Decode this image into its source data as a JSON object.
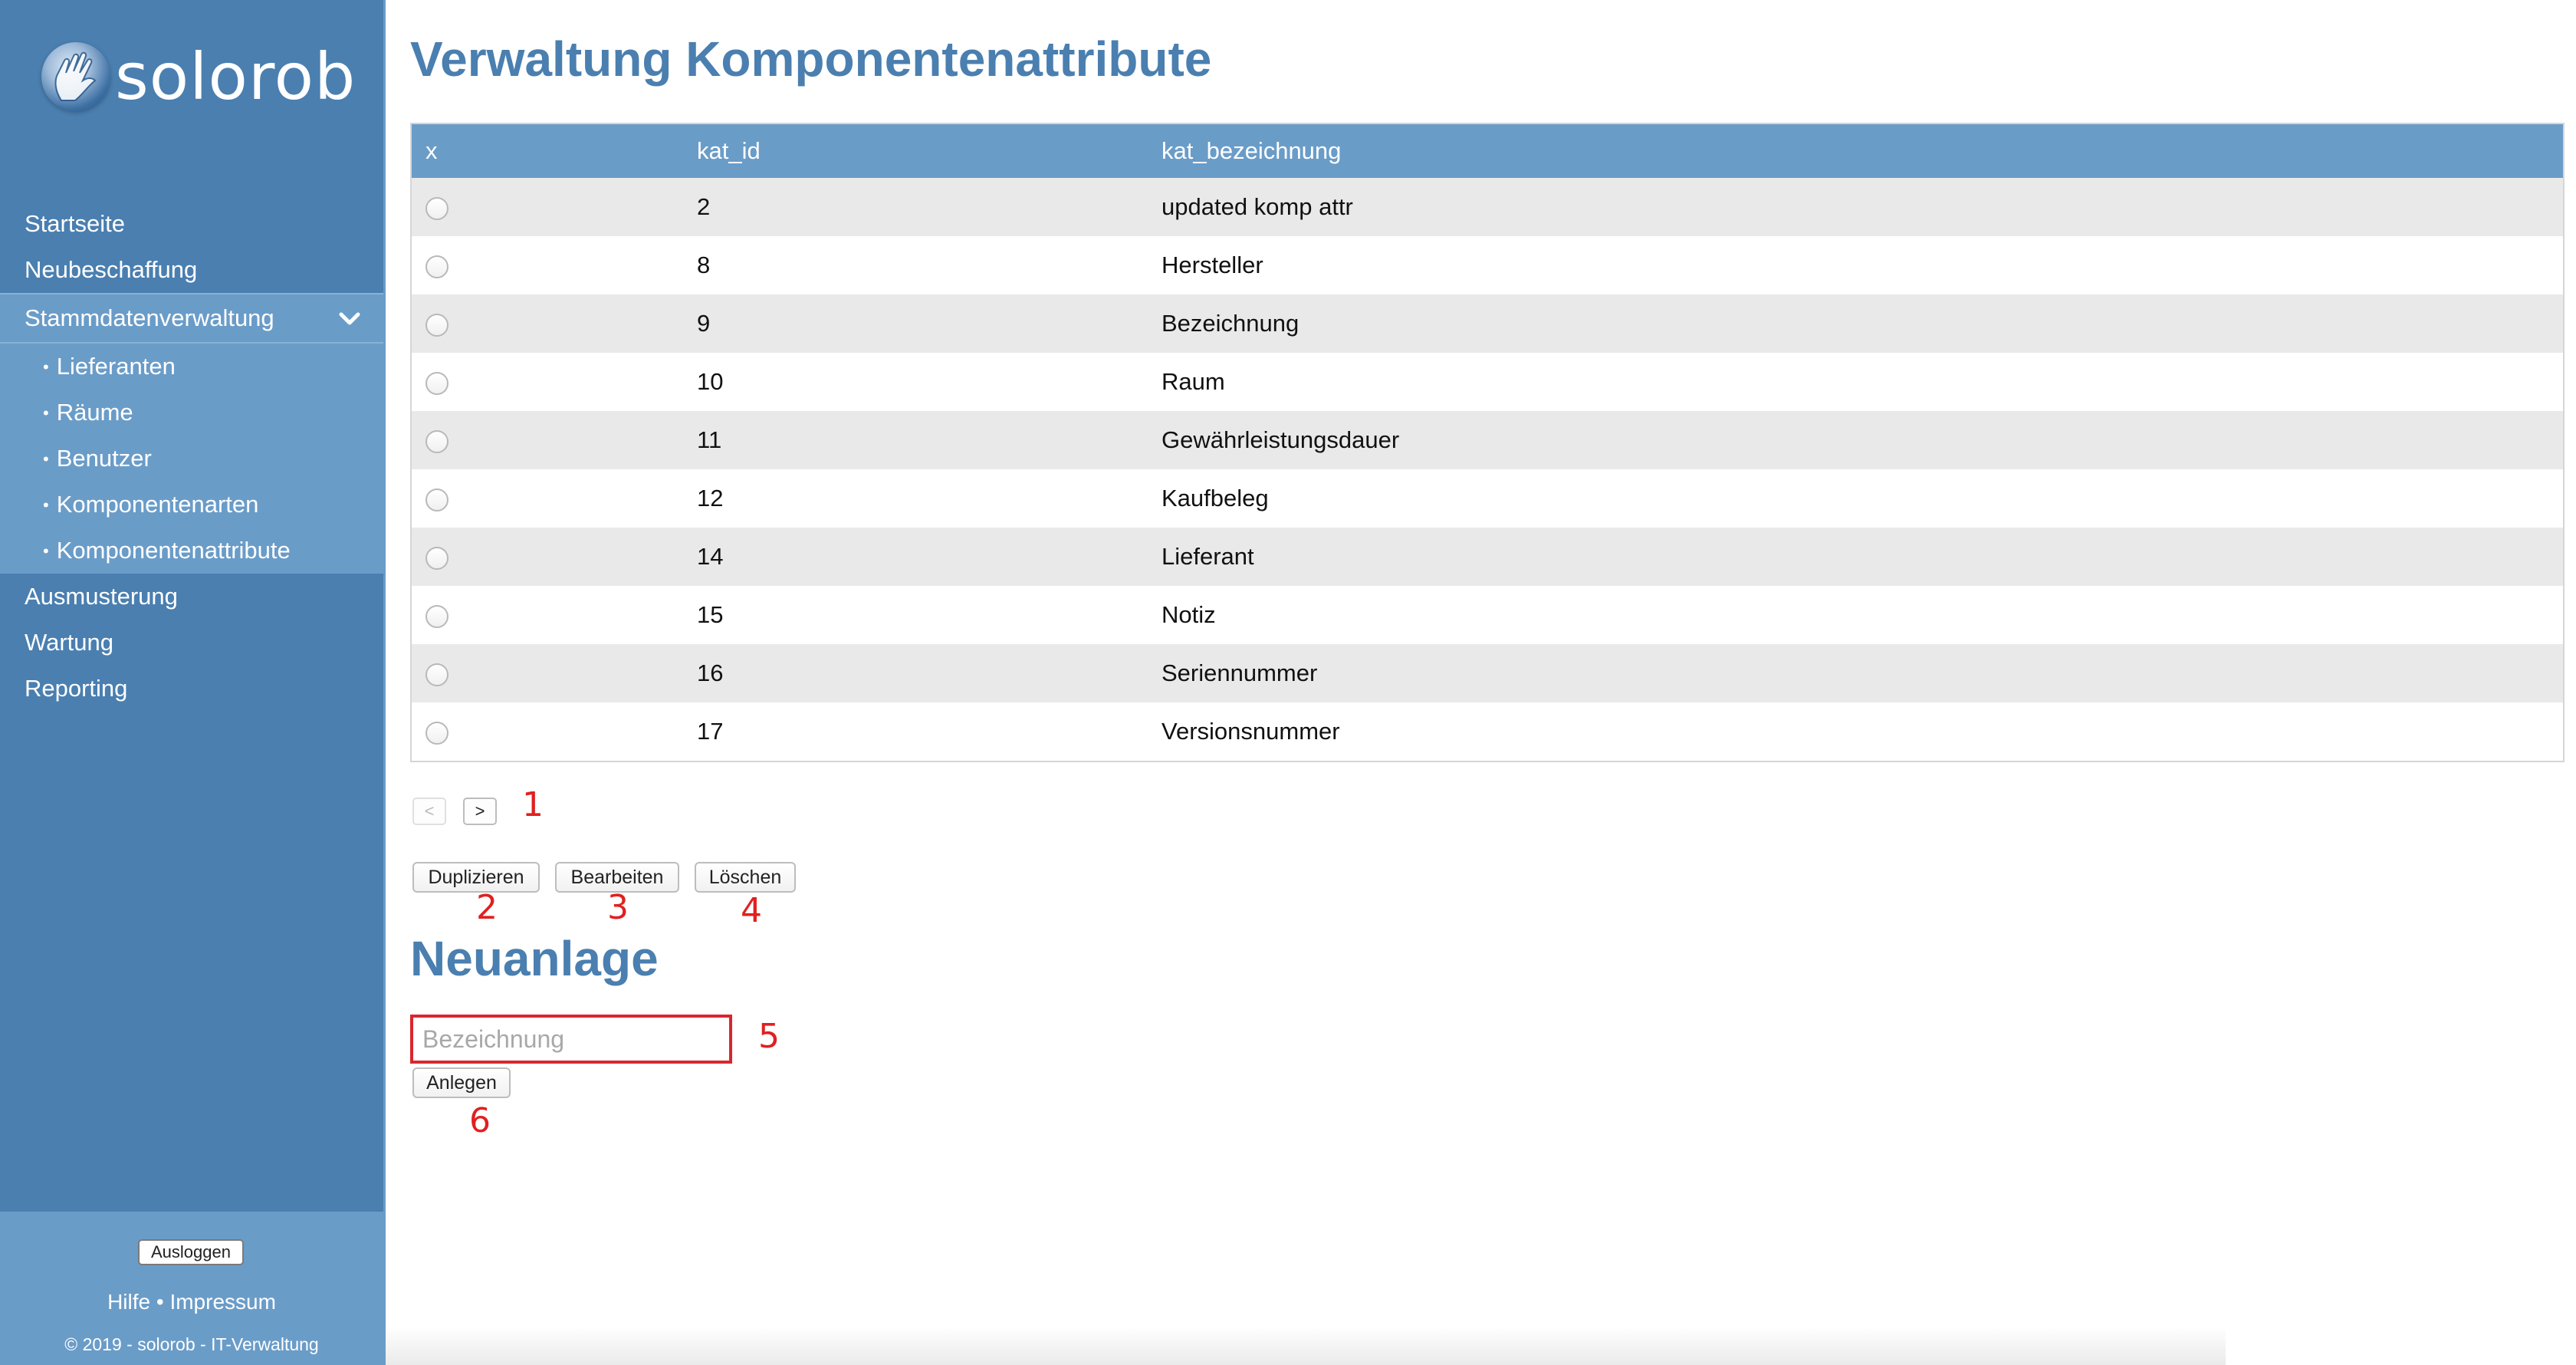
{
  "app": {
    "logo_text": "solorob"
  },
  "sidebar": {
    "items": [
      {
        "label": "Startseite"
      },
      {
        "label": "Neubeschaffung"
      },
      {
        "label": "Stammdatenverwaltung"
      },
      {
        "label": "Ausmusterung"
      },
      {
        "label": "Wartung"
      },
      {
        "label": "Reporting"
      }
    ],
    "subitems": [
      {
        "label": "Lieferanten"
      },
      {
        "label": "Räume"
      },
      {
        "label": "Benutzer"
      },
      {
        "label": "Komponentenarten"
      },
      {
        "label": "Komponentenattribute"
      }
    ],
    "bullet": "•",
    "logout_label": "Ausloggen",
    "footer_help": "Hilfe",
    "footer_sep": "•",
    "footer_impressum": "Impressum",
    "copyright": "© 2019 - solorob - IT-Verwaltung"
  },
  "main": {
    "title": "Verwaltung Komponentenattribute",
    "table": {
      "headers": [
        "x",
        "kat_id",
        "kat_bezeichnung"
      ],
      "rows": [
        {
          "id": "2",
          "name": "updated komp attr"
        },
        {
          "id": "8",
          "name": "Hersteller"
        },
        {
          "id": "9",
          "name": "Bezeichnung"
        },
        {
          "id": "10",
          "name": "Raum"
        },
        {
          "id": "11",
          "name": "Gewährleistungsdauer"
        },
        {
          "id": "12",
          "name": "Kaufbeleg"
        },
        {
          "id": "14",
          "name": "Lieferant"
        },
        {
          "id": "15",
          "name": "Notiz"
        },
        {
          "id": "16",
          "name": "Seriennummer"
        },
        {
          "id": "17",
          "name": "Versionsnummer"
        }
      ]
    },
    "pager": {
      "prev": "<",
      "next": ">"
    },
    "actions": {
      "duplicate": "Duplizieren",
      "edit": "Bearbeiten",
      "delete": "Löschen"
    },
    "new_section": {
      "title": "Neuanlage",
      "input_placeholder": "Bezeichnung",
      "input_value": "",
      "create_label": "Anlegen"
    }
  },
  "annotations": [
    "1",
    "2",
    "3",
    "4",
    "5",
    "6"
  ],
  "colors": {
    "sidebar_bg": "#4a7fb0",
    "sidebar_active": "#6a9cc8",
    "title": "#4a7fb0",
    "annotation": "#e02020",
    "highlight_border": "#d9262f"
  }
}
